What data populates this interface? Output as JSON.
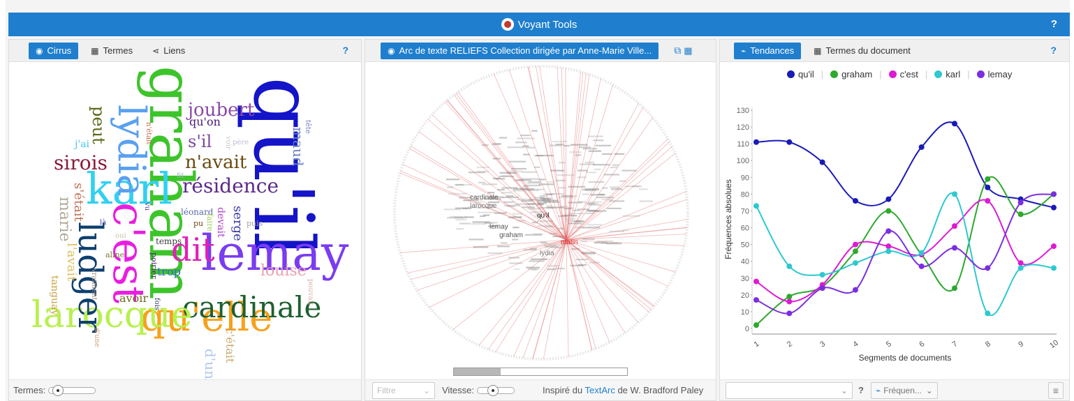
{
  "app": {
    "title": "Voyant Tools",
    "help": "?"
  },
  "panel1": {
    "tabs": [
      {
        "label": "Cirrus",
        "icon": "eye-icon"
      },
      {
        "label": "Termes",
        "icon": "table-icon"
      },
      {
        "label": "Liens",
        "icon": "share-icon"
      }
    ],
    "help": "?",
    "footer_label": "Termes:",
    "slider_value": 0.1,
    "words": [
      {
        "text": "qu'il",
        "color": "#1414c8"
      },
      {
        "text": "graham",
        "color": "#3ec42b"
      },
      {
        "text": "karl",
        "color": "#31d0f2"
      },
      {
        "text": "lydia",
        "color": "#5aa0f0"
      },
      {
        "text": "lemay",
        "color": "#7a3cf0"
      },
      {
        "text": "c'est",
        "color": "#e81ee0"
      },
      {
        "text": "qu'elle",
        "color": "#f7a11a"
      },
      {
        "text": "cardinale",
        "color": "#1e6030"
      },
      {
        "text": "larocque",
        "color": "#b8f050"
      },
      {
        "text": "ludger",
        "color": "#0d3f6e"
      },
      {
        "text": "dit",
        "color": "#e020b8"
      },
      {
        "text": "résidence",
        "color": "#5a2a8a"
      },
      {
        "text": "n'avait",
        "color": "#6a4a10"
      },
      {
        "text": "joubert",
        "color": "#8a4aa8"
      },
      {
        "text": "sirois",
        "color": "#8a1a3a"
      },
      {
        "text": "peut",
        "color": "#5a6a18"
      },
      {
        "text": "s'il",
        "color": "#7a4a9a"
      },
      {
        "text": "qu'on",
        "color": "#4a1a7a"
      },
      {
        "text": "maud",
        "color": "#6a80c8"
      },
      {
        "text": "louise",
        "color": "#e8a0b0"
      },
      {
        "text": "marie",
        "color": "#b0a898"
      },
      {
        "text": "s'était",
        "color": "#c07050"
      },
      {
        "text": "l'avait",
        "color": "#e0c060"
      },
      {
        "text": "tanguay",
        "color": "#c8a040"
      },
      {
        "text": "serge",
        "color": "#3a3aa8"
      },
      {
        "text": "devait",
        "color": "#b040c8"
      },
      {
        "text": "léonard",
        "color": "#5a6aa8"
      },
      {
        "text": "avoir",
        "color": "#6a6a20"
      },
      {
        "text": "trop",
        "color": "#3a6ac8"
      },
      {
        "text": "d'un",
        "color": "#b0c8e8"
      },
      {
        "text": "c'était",
        "color": "#c8a868"
      },
      {
        "text": "j'ai",
        "color": "#4ac8e8"
      },
      {
        "text": "temps",
        "color": "#3a3a3a"
      },
      {
        "text": "aline",
        "color": "#7a7a3a"
      },
      {
        "text": "poirier",
        "color": "#4a2a6a"
      },
      {
        "text": "puis",
        "color": "#a0a0a0"
      },
      {
        "text": "faire",
        "color": "#a0d060"
      },
      {
        "text": "pu",
        "color": "#6a4a18"
      },
      {
        "text": "fit",
        "color": "#a0b0c0"
      },
      {
        "text": "vu",
        "color": "#4a3a8a"
      },
      {
        "text": "là",
        "color": "#3a3a9a"
      },
      {
        "text": "oui",
        "color": "#c8c0a8"
      },
      {
        "text": "voir",
        "color": "#c8c8d0"
      },
      {
        "text": "père",
        "color": "#b8c0d0"
      },
      {
        "text": "tête",
        "color": "#6a7ab8"
      },
      {
        "text": "n'était",
        "color": "#c06040"
      },
      {
        "text": "fois",
        "color": "#2a3a5a"
      },
      {
        "text": "vraiment",
        "color": "#a09080"
      },
      {
        "text": "d'une",
        "color": "#d0a070"
      },
      {
        "text": "pouvait",
        "color": "#d8b0a8"
      }
    ]
  },
  "panel2": {
    "tab": {
      "label": "Arc de texte RELIEFS Collection dirigée par Anne-Marie Ville...",
      "icon": "eye-icon"
    },
    "icons": [
      "external-link-icon",
      "windows-icon"
    ],
    "arc_labels": [
      {
        "text": "qu'il",
        "color": "#222222"
      },
      {
        "text": "matin",
        "color": "#e02020"
      },
      {
        "text": "cardinale",
        "color": "#555555"
      },
      {
        "text": "larocque",
        "color": "#777777"
      },
      {
        "text": "lemay",
        "color": "#555555"
      },
      {
        "text": "graham",
        "color": "#555555"
      },
      {
        "text": "lydia",
        "color": "#777777"
      }
    ],
    "progress": 0.27,
    "filter_placeholder": "Filtre",
    "speed_label": "Vitesse:",
    "speed_value": 0.4,
    "credit_prefix": "Inspiré du ",
    "credit_link": "TextArc",
    "credit_suffix": " de W. Bradford Paley"
  },
  "panel3": {
    "tabs": [
      {
        "label": "Tendances",
        "icon": "trend-icon"
      },
      {
        "label": "Termes du document",
        "icon": "table-icon"
      }
    ],
    "help": "?",
    "footer": {
      "combo_value": "",
      "help": "?",
      "mode_label": "Fréquen...",
      "menu_icon": "menu-icon"
    }
  },
  "chart_data": {
    "type": "line",
    "x": [
      1,
      2,
      3,
      4,
      5,
      6,
      7,
      8,
      9,
      10
    ],
    "xlabel": "Segments de documents",
    "ylabel": "Fréquences absolues",
    "ylim": [
      0,
      130
    ],
    "yticks": [
      0,
      10,
      20,
      30,
      40,
      50,
      60,
      70,
      80,
      90,
      100,
      110,
      120,
      130
    ],
    "legend_position": "top",
    "series": [
      {
        "name": "qu'il",
        "color": "#1a1ab8",
        "values": [
          111,
          111,
          99,
          76,
          77,
          108,
          122,
          84,
          77,
          72
        ]
      },
      {
        "name": "graham",
        "color": "#2ea82e",
        "values": [
          2,
          19,
          25,
          46,
          70,
          44,
          24,
          89,
          68,
          80
        ]
      },
      {
        "name": "c'est",
        "color": "#dd1ad4",
        "values": [
          28,
          16,
          26,
          50,
          49,
          44,
          61,
          76,
          39,
          49
        ]
      },
      {
        "name": "karl",
        "color": "#2ec8d0",
        "values": [
          73,
          37,
          32,
          39,
          46,
          45,
          80,
          9,
          36,
          36
        ]
      },
      {
        "name": "lemay",
        "color": "#7a2ee0",
        "values": [
          17,
          9,
          24,
          23,
          58,
          37,
          48,
          36,
          75,
          80
        ]
      }
    ]
  }
}
